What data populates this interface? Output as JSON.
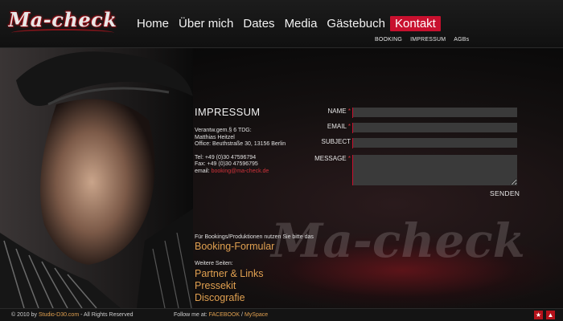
{
  "logo": {
    "text": "Ma-check"
  },
  "nav": {
    "items": [
      {
        "label": "Home"
      },
      {
        "label": "Über mich"
      },
      {
        "label": "Dates"
      },
      {
        "label": "Media"
      },
      {
        "label": "Gästebuch"
      },
      {
        "label": "Kontakt",
        "active": true
      }
    ]
  },
  "subnav": {
    "items": [
      {
        "label": "BOOKING"
      },
      {
        "label": "IMPRESSUM"
      },
      {
        "label": "AGBs"
      }
    ]
  },
  "impressum": {
    "title": "IMPRESSUM",
    "lines": [
      "Verantw.gem.§ 6 TDG:",
      "Matthias Heitzel",
      "Office: Beuthstraße 30, 13156 Berlin"
    ],
    "tel": "Tel:  +49 (0)30 47596794",
    "fax": "Fax:  +49 (0)30 47596795",
    "email_label": "email: ",
    "email": "booking@ma-check.de",
    "booking_intro": "Für Bookings/Produktionen nutzen Sie bitte das",
    "booking_link": "Booking-Formular",
    "further_label": "Weitere Seiten:",
    "further_links": [
      {
        "label": "Partner & Links"
      },
      {
        "label": "Pressekit"
      },
      {
        "label": "Discografie"
      }
    ]
  },
  "form": {
    "name_label": "NAME",
    "email_label": "EMAIL",
    "subject_label": "SUBJECT",
    "message_label": "MESSAGE",
    "required_mark": "*",
    "name_value": "",
    "email_value": "",
    "subject_value": "",
    "message_value": "",
    "send_label": "SENDEN"
  },
  "footer": {
    "copyright_prefix": "© 2010 by ",
    "studio": "Studio-D30.com",
    "copyright_suffix": " - All Rights Reserved",
    "follow_prefix": "Follow me at: ",
    "facebook": "FACEBOOK",
    "separator": " / ",
    "myspace": "MySpace",
    "icons": [
      {
        "name": "bookmark-icon",
        "glyph": "★"
      },
      {
        "name": "share-icon",
        "glyph": "▲"
      }
    ]
  },
  "background_logo": "Ma-check",
  "colors": {
    "accent": "#c8102e",
    "link": "#e0a050",
    "background": "#0b0b0b"
  }
}
